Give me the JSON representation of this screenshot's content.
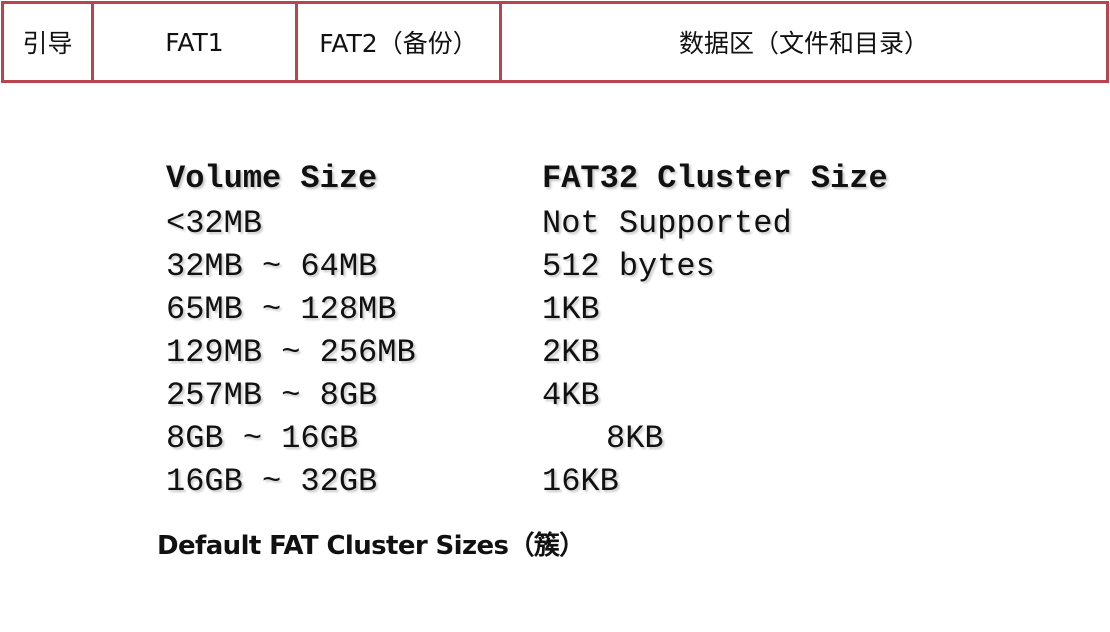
{
  "layout_bar": {
    "segments": [
      "引导",
      "FAT1",
      "FAT2（备份）",
      "数据区（文件和目录）"
    ],
    "border_color": "#b9444e"
  },
  "table": {
    "headers": [
      "Volume Size",
      "FAT32 Cluster Size"
    ],
    "rows": [
      [
        "<32MB",
        "Not Supported"
      ],
      [
        "32MB ~ 64MB",
        "512 bytes"
      ],
      [
        "65MB ~ 128MB",
        "1KB"
      ],
      [
        "129MB ~ 256MB",
        "2KB"
      ],
      [
        "257MB ~ 8GB",
        "4KB"
      ],
      [
        "8GB ~ 16GB",
        "8KB"
      ],
      [
        "16GB ~ 32GB",
        "16KB"
      ]
    ]
  },
  "caption": "Default FAT Cluster Sizes（簇）"
}
